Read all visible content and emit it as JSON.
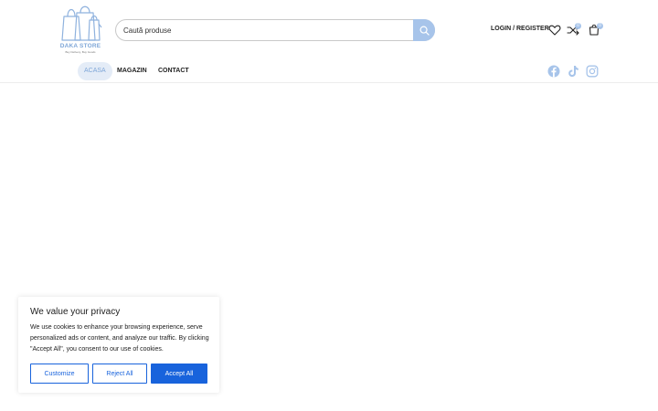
{
  "logo": {
    "name": "DAKA STORE",
    "tagline": "Buy Delivery, Buy Goods"
  },
  "search": {
    "placeholder": "Caută produse"
  },
  "header": {
    "login_label": "LOGIN / REGISTER",
    "compare_count": "0",
    "cart_count": "0",
    "icons": [
      "heart-icon",
      "compare-icon",
      "cart-icon"
    ]
  },
  "nav": {
    "items": [
      {
        "label": "ACASA",
        "active": true
      },
      {
        "label": "MAGAZIN",
        "active": false
      },
      {
        "label": "CONTACT",
        "active": false
      }
    ],
    "social": [
      "facebook-icon",
      "tiktok-icon",
      "instagram-icon"
    ]
  },
  "cookie": {
    "title": "We value your privacy",
    "text": "We use cookies to enhance your browsing experience, serve personalized ads or content, and analyze our traffic. By clicking \"Accept All\", you consent to our use of cookies.",
    "customize_label": "Customize",
    "reject_label": "Reject All",
    "accept_label": "Accept All"
  },
  "colors": {
    "accent": "#a7c4ea",
    "cookie_primary": "#1863dc",
    "logo": "#7fa7d8"
  }
}
